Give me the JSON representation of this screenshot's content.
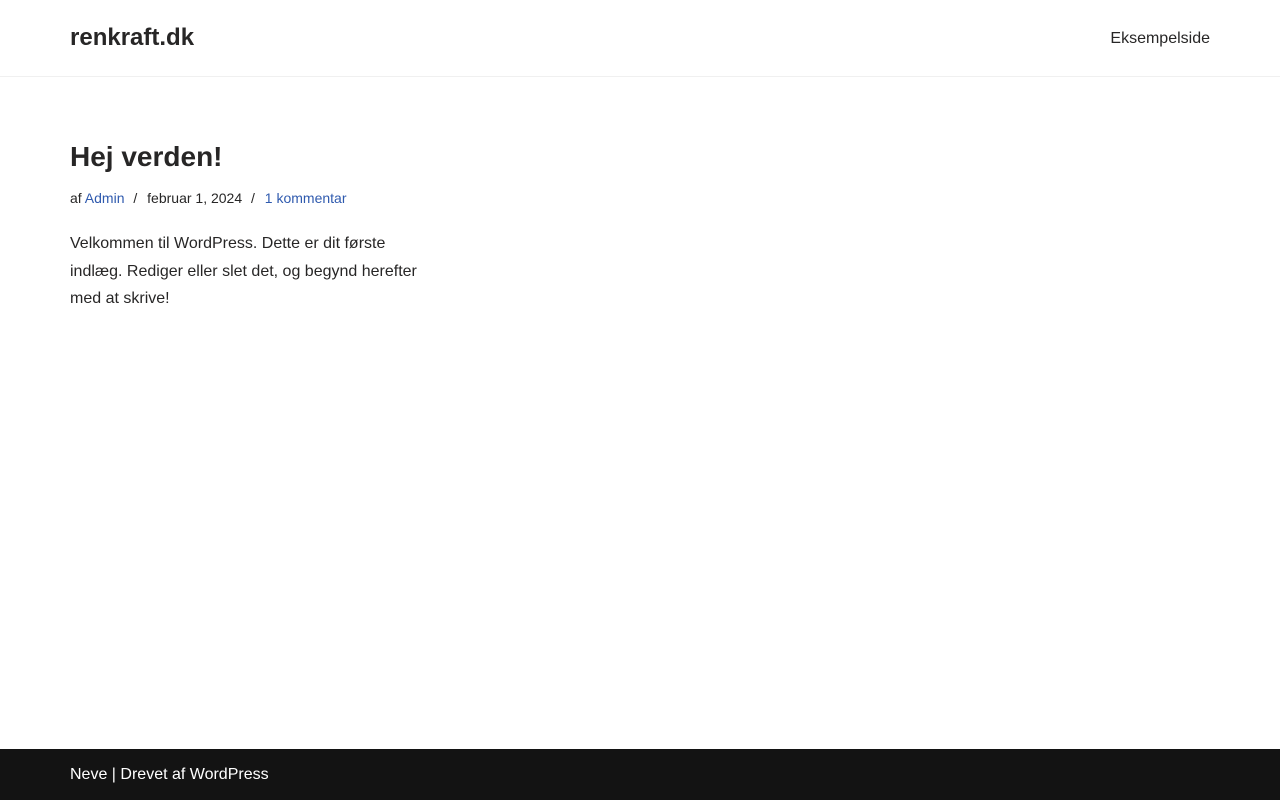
{
  "header": {
    "site_title": "renkraft.dk",
    "nav": {
      "item_1": "Eksempelside"
    }
  },
  "post": {
    "title": "Hej verden!",
    "meta": {
      "by_prefix": "af",
      "author": "Admin",
      "separator": "/",
      "date": "februar 1, 2024",
      "comments": "1 kommentar"
    },
    "excerpt": "Velkommen til WordPress. Dette er dit første indlæg. Rediger eller slet det, og begynd herefter med at skrive!"
  },
  "footer": {
    "theme_link": "Neve",
    "divider": " | ",
    "powered_link": "Drevet af WordPress"
  },
  "colors": {
    "text": "#272626",
    "link": "#2f5aae",
    "footer_bg": "#131313",
    "footer_text": "#ffffff"
  }
}
